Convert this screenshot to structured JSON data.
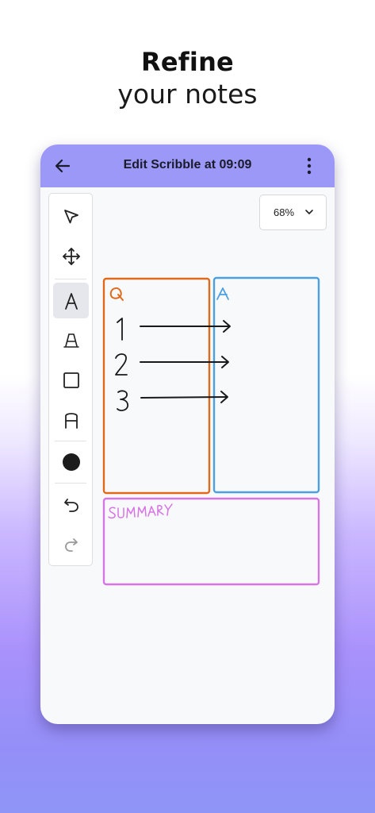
{
  "headline": {
    "line1": "Refine",
    "line2": "your notes"
  },
  "appbar": {
    "title": "Edit Scribble at 09:09",
    "back_icon": "arrow-left-icon",
    "menu_icon": "more-vertical-icon",
    "color": "#9b98f7"
  },
  "zoom": {
    "value": "68%"
  },
  "toolbar": {
    "tools": [
      {
        "name": "select-tool",
        "icon": "cursor-arrow-icon",
        "active": false
      },
      {
        "name": "move-tool",
        "icon": "move-arrows-icon",
        "active": false
      },
      {
        "name": "text-tool",
        "icon": "letter-a-icon",
        "active": true
      },
      {
        "name": "outline-text-tool",
        "icon": "letter-a-outline-icon",
        "active": false
      },
      {
        "name": "rectangle-tool",
        "icon": "square-icon",
        "active": false
      },
      {
        "name": "shape-text-tool",
        "icon": "letter-a-square-icon",
        "active": false
      },
      {
        "name": "color-tool",
        "icon": "filled-circle-icon",
        "active": false
      },
      {
        "name": "undo-tool",
        "icon": "undo-icon",
        "active": false
      },
      {
        "name": "redo-tool",
        "icon": "redo-icon",
        "active": false
      }
    ]
  },
  "scribble": {
    "q_label": "Q",
    "a_label": "A",
    "numbers": [
      "1",
      "2",
      "3"
    ],
    "summary_label": "SUMMARY",
    "colors": {
      "q_box": "#e06a1c",
      "a_box": "#4aa0e0",
      "summary_box": "#d774e6",
      "ink": "#1a1a1a"
    }
  }
}
